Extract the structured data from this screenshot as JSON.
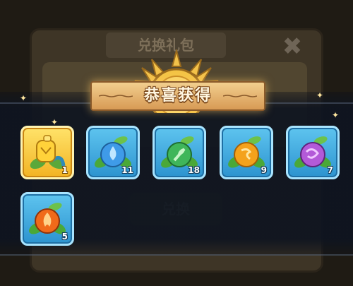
{
  "background_dialog": {
    "title": "兑换礼包",
    "close_glyph": "✖",
    "exchange_button": "兑换"
  },
  "reward_popup": {
    "banner_title": "恭喜获得",
    "items": [
      {
        "icon": "golden-seed-icon",
        "count": "1",
        "rarity": "gold",
        "color": "#f2c12e"
      },
      {
        "icon": "water-seed-icon",
        "count": "11",
        "rarity": "blue",
        "color": "#3f9be8"
      },
      {
        "icon": "leaf-seed-icon",
        "count": "18",
        "rarity": "blue",
        "color": "#3fb65a"
      },
      {
        "icon": "sun-seed-icon",
        "count": "9",
        "rarity": "blue",
        "color": "#f4a21c"
      },
      {
        "icon": "purple-seed-icon",
        "count": "7",
        "rarity": "blue",
        "color": "#b35ad8"
      },
      {
        "icon": "fire-seed-icon",
        "count": "5",
        "rarity": "blue",
        "color": "#f06a1a"
      }
    ]
  }
}
